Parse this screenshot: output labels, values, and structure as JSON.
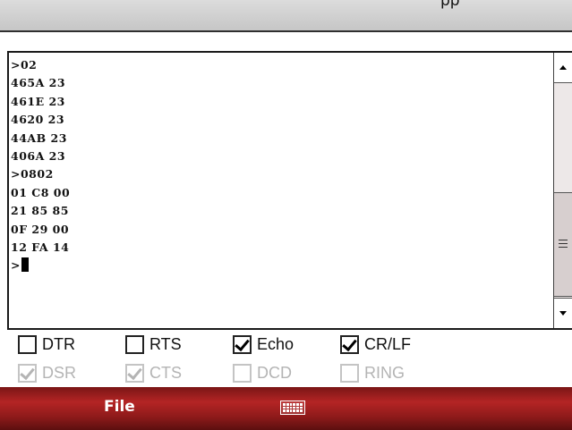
{
  "window": {
    "title": "pp"
  },
  "terminal": {
    "lines": [
      ">02",
      "465A 23",
      "461E 23",
      "4620 23",
      "44AB 23",
      "406A 23",
      ">0802",
      "01 C8 00",
      "21 85 85",
      "0F 29 00",
      "12 FA 14"
    ],
    "prompt": ">"
  },
  "signals": [
    {
      "label": "DTR",
      "checked": false,
      "enabled": true
    },
    {
      "label": "RTS",
      "checked": false,
      "enabled": true
    },
    {
      "label": "Echo",
      "checked": true,
      "enabled": true
    },
    {
      "label": "CR/LF",
      "checked": true,
      "enabled": true
    },
    {
      "label": "DSR",
      "checked": true,
      "enabled": false
    },
    {
      "label": "CTS",
      "checked": true,
      "enabled": false
    },
    {
      "label": "DCD",
      "checked": false,
      "enabled": false
    },
    {
      "label": "RING",
      "checked": false,
      "enabled": false
    }
  ],
  "menubar": {
    "file_label": "File",
    "keyboard_icon": "keyboard-icon"
  },
  "colors": {
    "menubar": "#a61f1f",
    "titlebar": "#d0d0d0"
  }
}
